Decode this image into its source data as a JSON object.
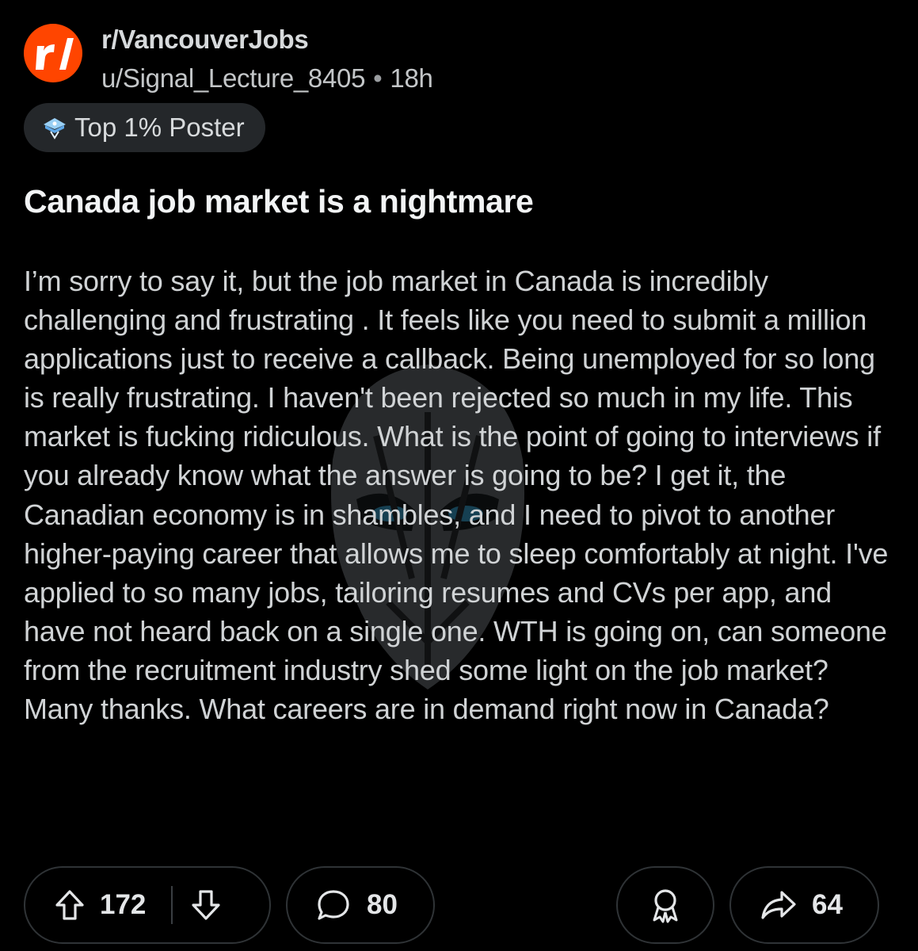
{
  "post": {
    "subreddit": "r/VancouverJobs",
    "author": "u/Signal_Lecture_8405",
    "separator": "•",
    "age": "18h",
    "flair": "Top 1% Poster",
    "title": "Canada job market is a nightmare",
    "body": "I’m sorry to say it, but the job market in Canada is incredibly challenging and frustrating . It feels like you need to submit a million applications just to receive a callback. Being unemployed for so long is really frustrating. I haven't been rejected so much in my life. This market is fucking ridiculous. What is the point of going to interviews if you already know what the answer is going to be? I get it, the Canadian economy is in shambles, and I need to pivot to another higher-paying career that allows me to sleep comfortably at night. I've applied to so many jobs, tailoring resumes and CVs per app, and have not heard back on a single one. WTH is going on, can someone from the recruitment industry shed some light on the job market? Many thanks. What careers are in demand right now in Canada?"
  },
  "actions": {
    "upvotes": "172",
    "comments": "80",
    "shares": "64"
  },
  "icons": {
    "avatar": "subreddit-logo-icon",
    "flair": "trophy-icon",
    "upvote": "arrow-up-icon",
    "downvote": "arrow-down-icon",
    "comment": "speech-bubble-icon",
    "award": "award-icon",
    "share": "share-arrow-icon"
  },
  "colors": {
    "background": "#000000",
    "avatar": "#ff4500",
    "pill_border": "#2f3336",
    "flair_bg": "#24272a"
  }
}
